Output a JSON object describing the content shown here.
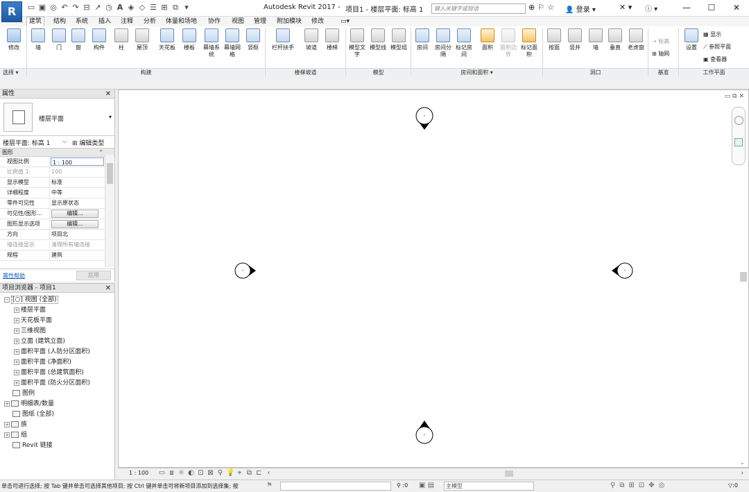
{
  "app": {
    "logo": "R",
    "title": "Autodesk Revit 2017 -",
    "document_title": "项目1 - 楼层平面: 标高 1",
    "search_placeholder": "键入关键字或短语",
    "login": "登录",
    "window": {
      "minimize": "—",
      "maximize": "☐",
      "close": "✕"
    }
  },
  "ribbon": {
    "tabs": [
      "建筑",
      "结构",
      "系统",
      "插入",
      "注释",
      "分析",
      "体量和场地",
      "协作",
      "视图",
      "管理",
      "附加模块",
      "修改"
    ],
    "active_tab": "建筑",
    "buttons": {
      "modify": "修改",
      "wall": "墙",
      "door": "门",
      "window": "窗",
      "component": "构件",
      "column": "柱",
      "roof": "屋顶",
      "ceiling": "天花板",
      "floor": "楼板",
      "curtain_system": "幕墙系统",
      "curtain_grid": "幕墙网格",
      "mullion": "竖梃",
      "railing": "栏杆扶手",
      "ramp": "坡道",
      "stair": "楼梯",
      "model_text": "模型文字",
      "model_line": "模型线",
      "model_group": "模型组",
      "room": "房间",
      "room_separator": "房间分隔",
      "tag_room": "标记房间",
      "area": "面积",
      "area_boundary": "面积边界",
      "tag_area": "标记面积",
      "by_face": "按面",
      "shaft": "竖井",
      "opening_wall": "墙",
      "vertical": "垂直",
      "dormer": "老虎窗",
      "level": "标高",
      "grid": "轴网",
      "set": "设置",
      "show": "显示",
      "ref_plane": "参照平面",
      "viewer": "查看器"
    },
    "panels": {
      "select": "选择 ▾",
      "build": "构建",
      "circulation": "楼梯坡道",
      "model": "模型",
      "room_area": "房间和面积 ▾",
      "opening": "洞口",
      "datum": "基准",
      "work_plane": "工作平面"
    }
  },
  "properties": {
    "title": "属性",
    "type_name": "楼层平面",
    "selector": "楼层平面: 标高 1",
    "edit_type": "编辑类型",
    "category": "图形",
    "rows": [
      {
        "key": "视图比例",
        "value": "1 : 100",
        "boxed": true
      },
      {
        "key": "比例值 1:",
        "value": "100",
        "dim": true
      },
      {
        "key": "显示模型",
        "value": "标准"
      },
      {
        "key": "详细程度",
        "value": "中等"
      },
      {
        "key": "零件可见性",
        "value": "显示原状态"
      },
      {
        "key": "可见性/图形...",
        "button": "编辑..."
      },
      {
        "key": "图形显示选项",
        "button": "编辑..."
      },
      {
        "key": "方向",
        "value": "项目北"
      },
      {
        "key": "墙连接显示",
        "value": "清理所有墙连接",
        "dim": true
      },
      {
        "key": "规程",
        "value": "建筑"
      }
    ],
    "help": "属性帮助",
    "apply": "应用"
  },
  "browser": {
    "title": "项目浏览器 - 项目1",
    "items": [
      {
        "label": "[○] 视图 (全部)",
        "toggle": "−",
        "level": 0,
        "highlight": true
      },
      {
        "label": "楼层平面",
        "toggle": "+",
        "level": 1
      },
      {
        "label": "天花板平面",
        "toggle": "+",
        "level": 1
      },
      {
        "label": "三维视图",
        "toggle": "+",
        "level": 1
      },
      {
        "label": "立面 (建筑立面)",
        "toggle": "+",
        "level": 1
      },
      {
        "label": "面积平面 (人防分区面积)",
        "toggle": "+",
        "level": 1
      },
      {
        "label": "面积平面 (净面积)",
        "toggle": "+",
        "level": 1
      },
      {
        "label": "面积平面 (总建筑面积)",
        "toggle": "+",
        "level": 1
      },
      {
        "label": "面积平面 (防火分区面积)",
        "toggle": "+",
        "level": 1
      },
      {
        "label": "图例",
        "toggle": "",
        "level": 0,
        "icon": true
      },
      {
        "label": "明细表/数量",
        "toggle": "+",
        "level": 0,
        "icon": true
      },
      {
        "label": "图纸 (全部)",
        "toggle": "",
        "level": 0,
        "icon": true
      },
      {
        "label": "族",
        "toggle": "+",
        "level": 0,
        "icon": true
      },
      {
        "label": "组",
        "toggle": "+",
        "level": 0,
        "icon": true
      },
      {
        "label": "Revit 链接",
        "toggle": "",
        "level": 0,
        "icon": true
      }
    ]
  },
  "view": {
    "scale": "1 : 100",
    "elevation_marker_label": "-"
  },
  "status": {
    "message": "单击可进行选择; 按 Tab 键并单击可选择其他项目; 按 Ctrl 键并单击可将新项目添加到选择集; 按",
    "selection_count": ":0",
    "model": "主模型",
    "filter_count": ":0"
  }
}
